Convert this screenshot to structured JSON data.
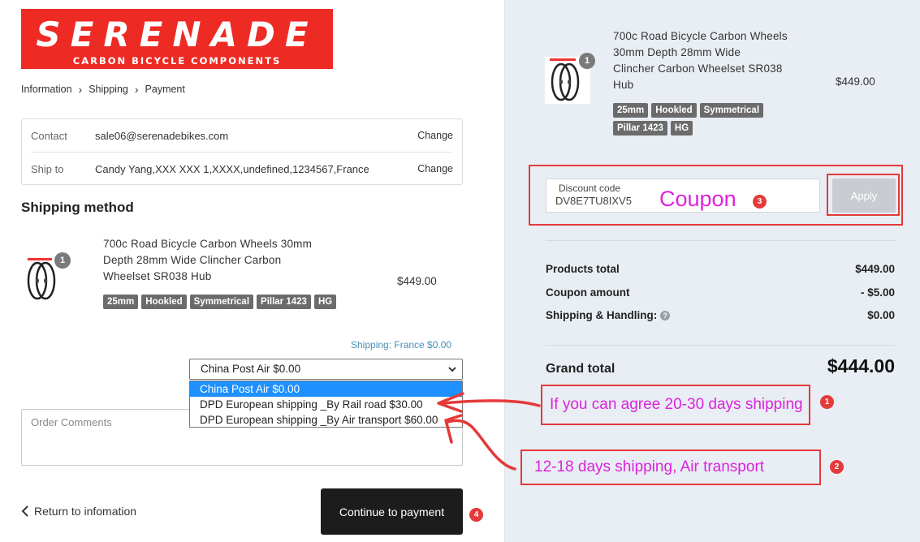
{
  "logo": {
    "main": "SERENADE",
    "sub": "CARBON BICYCLE COMPONENTS"
  },
  "breadcrumb": {
    "information": "Information",
    "shipping": "Shipping",
    "payment": "Payment"
  },
  "contact": {
    "label": "Contact",
    "value": "sale06@serenadebikes.com",
    "change": "Change"
  },
  "ship_to": {
    "label": "Ship to",
    "value": "Candy Yang,XXX XXX 1,XXXX,undefined,1234567,France",
    "change": "Change"
  },
  "shipping_method": {
    "title": "Shipping method",
    "shipping_note": "Shipping: France $0.00",
    "selected": "China Post Air $0.00",
    "options": [
      "China Post Air $0.00",
      "DPD European shipping _By Rail road $30.00",
      "DPD European shipping _By Air transport $60.00"
    ]
  },
  "product": {
    "qty": "1",
    "title_left": [
      "700c Road Bicycle Carbon Wheels 30mm",
      "Depth 28mm Wide Clincher Carbon",
      "Wheelset SR038 Hub"
    ],
    "title_right": [
      "700c Road Bicycle Carbon Wheels",
      "30mm Depth 28mm Wide",
      "Clincher Carbon Wheelset SR038",
      "Hub"
    ],
    "price": "$449.00",
    "tags": [
      "25mm",
      "Hookled",
      "Symmetrical",
      "Pillar 1423",
      "HG"
    ]
  },
  "comments": {
    "placeholder": "Order Comments"
  },
  "actions": {
    "return": "Return to infomation",
    "continue": "Continue to payment"
  },
  "discount": {
    "label": "Discount code",
    "value": "DV8E7TU8IXV5",
    "apply": "Apply"
  },
  "summary": {
    "products_total_label": "Products total",
    "products_total": "$449.00",
    "coupon_label": "Coupon amount",
    "coupon": "- $5.00",
    "shipping_label": "Shipping & Handling:",
    "shipping": "$0.00",
    "grand_label": "Grand total",
    "grand": "$444.00"
  },
  "annotations": {
    "coupon": "Coupon",
    "rail": "If you can agree 20-30 days shipping",
    "air": "12-18 days shipping, Air transport",
    "n1": "1",
    "n2": "2",
    "n3": "3",
    "n4": "4"
  },
  "colors": {
    "brand": "#ee2a24",
    "annotation_red": "#e43a3a",
    "annotation_text": "#dd22dd",
    "select_highlight": "#1e90ff"
  }
}
